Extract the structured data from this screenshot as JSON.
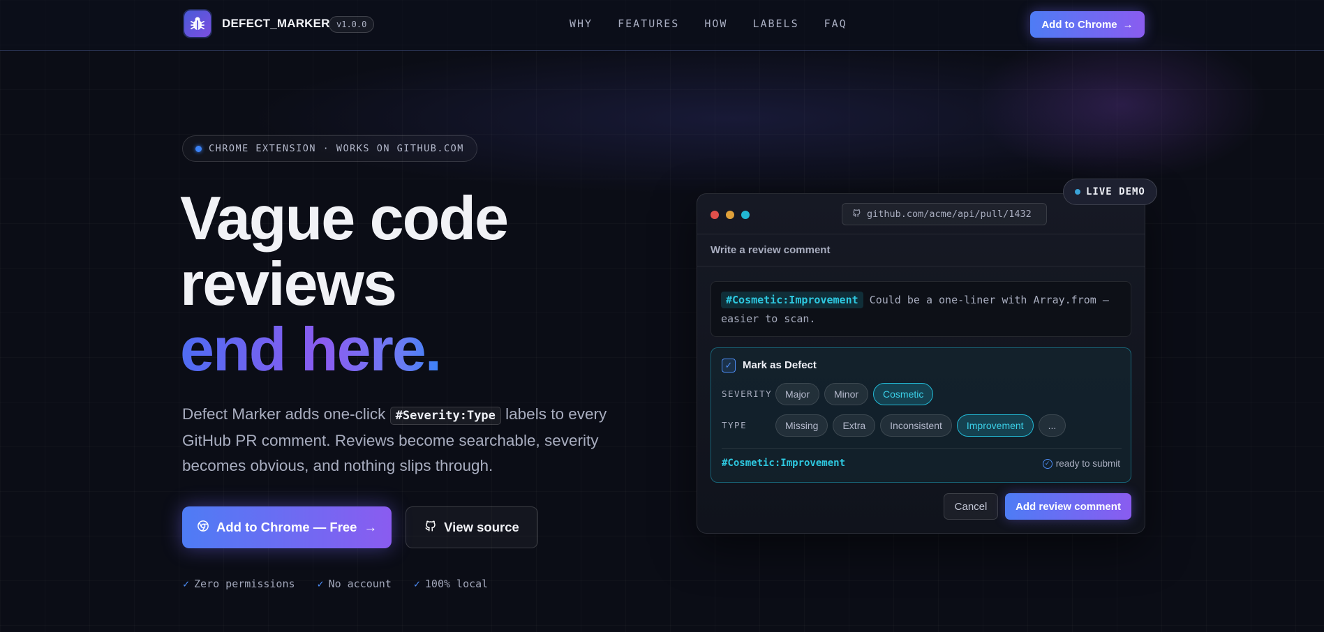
{
  "nav": {
    "brand": "DEFECT_MARKER",
    "version": "v1.0.0",
    "links": [
      "WHY",
      "FEATURES",
      "HOW",
      "LABELS",
      "FAQ"
    ],
    "cta": "Add to Chrome"
  },
  "hero": {
    "badge": "CHROME EXTENSION · WORKS ON GITHUB.COM",
    "headline_line1": "Vague code",
    "headline_line2": "reviews",
    "headline_line3": "end here.",
    "lead_before": "Defect Marker adds one-click ",
    "lead_code": "#Severity:Type",
    "lead_after": " labels to every GitHub PR comment. Reviews become searchable, severity becomes obvious, and nothing slips through.",
    "primary_button": "Add to Chrome — Free",
    "secondary_button": "View source",
    "checks": [
      "Zero permissions",
      "No account",
      "100% local"
    ]
  },
  "demo": {
    "live_label": "LIVE DEMO",
    "url": "github.com/acme/api/pull/1432",
    "section_title": "Write a review comment",
    "comment_tag": "#Cosmetic:Improvement",
    "comment_text": " Could be a one-liner with Array.from — easier to scan.",
    "defect_label": "Mark as Defect",
    "defect_checked": true,
    "severity_label": "SEVERITY",
    "severity_options": [
      "Major",
      "Minor",
      "Cosmetic"
    ],
    "severity_selected": "Cosmetic",
    "type_label": "TYPE",
    "type_options": [
      "Missing",
      "Extra",
      "Inconsistent",
      "Improvement",
      "..."
    ],
    "type_selected": "Improvement",
    "result_tag": "#Cosmetic:Improvement",
    "ready_text": "ready to submit",
    "cancel_button": "Cancel",
    "submit_button": "Add review comment"
  },
  "colors": {
    "accent_blue": "#4e7cf5",
    "accent_purple": "#8a5cf0",
    "accent_cyan": "#22b8d4",
    "background": "#0b0d16"
  }
}
